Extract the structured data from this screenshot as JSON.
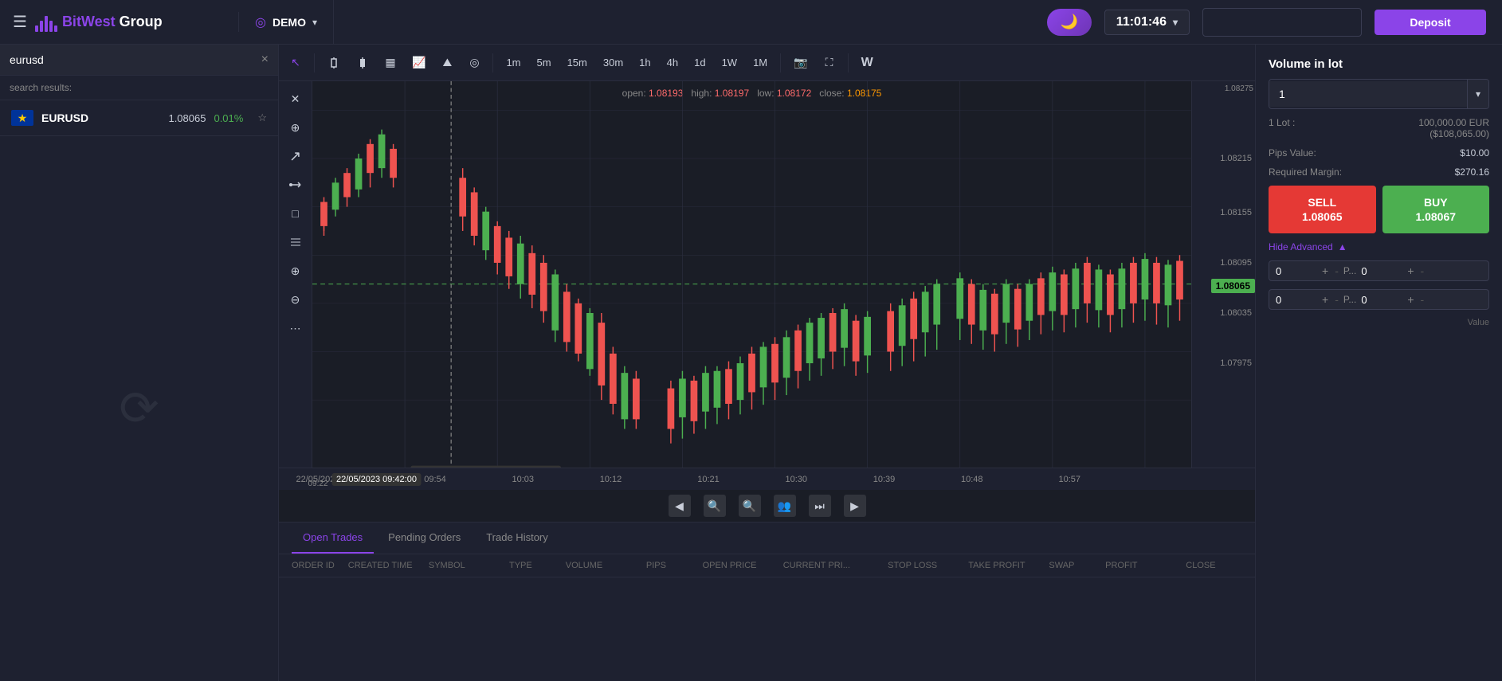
{
  "header": {
    "menu_icon": "☰",
    "logo_brand": "BitWest",
    "logo_suffix": " Group",
    "demo_label": "DEMO",
    "demo_arrow": "▾",
    "moon_icon": "🌙",
    "clock": "11:01:46",
    "clock_arrow": "▾",
    "deposit_label": "Deposit"
  },
  "search": {
    "placeholder": "eurusd",
    "results_label": "search results:",
    "clear_icon": "×",
    "results": [
      {
        "symbol": "EURUSD",
        "price": "1.08065",
        "change": "0.01%",
        "flag": "🇪🇺"
      }
    ]
  },
  "chart_toolbar": {
    "tools": [
      {
        "id": "cursor",
        "icon": "↖",
        "active": true
      },
      {
        "id": "separator1",
        "type": "sep"
      },
      {
        "id": "candle1",
        "icon": "⬜"
      },
      {
        "id": "candle2",
        "icon": "⬛"
      },
      {
        "id": "candle3",
        "icon": "▦"
      },
      {
        "id": "line",
        "icon": "📈"
      },
      {
        "id": "area",
        "icon": "⛰"
      },
      {
        "id": "heikin",
        "icon": "◎"
      },
      {
        "id": "separator2",
        "type": "sep"
      }
    ],
    "timeframes": [
      {
        "id": "1m",
        "label": "1m",
        "active": false
      },
      {
        "id": "5m",
        "label": "5m",
        "active": false
      },
      {
        "id": "15m",
        "label": "15m",
        "active": false
      },
      {
        "id": "30m",
        "label": "30m",
        "active": false
      },
      {
        "id": "1h",
        "label": "1h",
        "active": false
      },
      {
        "id": "4h",
        "label": "4h",
        "active": false
      },
      {
        "id": "1d",
        "label": "1d",
        "active": false
      },
      {
        "id": "1w",
        "label": "1W",
        "active": false
      },
      {
        "id": "1M",
        "label": "1M",
        "active": false
      }
    ],
    "extra_tools": [
      {
        "id": "camera",
        "icon": "📷"
      },
      {
        "id": "fullscreen",
        "icon": "⛶"
      },
      {
        "id": "separator3",
        "type": "sep"
      },
      {
        "id": "widget",
        "icon": "W"
      }
    ]
  },
  "left_tools": [
    {
      "id": "cross",
      "icon": "✕"
    },
    {
      "id": "zoom_in",
      "icon": "⊕"
    },
    {
      "id": "trend",
      "icon": "↗"
    },
    {
      "id": "shapes",
      "icon": "⚙"
    },
    {
      "id": "rect",
      "icon": "□"
    },
    {
      "id": "fib",
      "icon": "≡"
    },
    {
      "id": "zoom_plus",
      "icon": "⊕"
    },
    {
      "id": "zoom_minus",
      "icon": "⊖"
    },
    {
      "id": "more",
      "icon": "⋯"
    }
  ],
  "chart": {
    "info_bar": {
      "open_label": "open:",
      "open_value": "1.08193",
      "high_label": "high:",
      "high_value": "1.08197",
      "low_label": "low:",
      "low_value": "1.08172",
      "close_label": "close:",
      "close_value": "1.08175"
    },
    "price_levels": [
      {
        "value": "1.08275",
        "pct": 5,
        "highlighted": false
      },
      {
        "value": "1.08215",
        "pct": 18,
        "highlighted": false
      },
      {
        "value": "1.08155",
        "pct": 32,
        "highlighted": false
      },
      {
        "value": "1.08095",
        "pct": 45,
        "highlighted": false
      },
      {
        "value": "1.08065",
        "pct": 52,
        "highlighted": true,
        "color": "#4caf50"
      },
      {
        "value": "1.08035",
        "pct": 58,
        "highlighted": false
      },
      {
        "value": "1.07975",
        "pct": 72,
        "highlighted": false
      }
    ],
    "time_labels": [
      {
        "label": "22/05/2023",
        "pct": 4
      },
      {
        "label": "09:22",
        "pct": 4,
        "secondary": true
      },
      {
        "label": "09:54",
        "pct": 16
      },
      {
        "label": "10:03",
        "pct": 25
      },
      {
        "label": "10:12",
        "pct": 34
      },
      {
        "label": "10:21",
        "pct": 44
      },
      {
        "label": "10:30",
        "pct": 53
      },
      {
        "label": "10:39",
        "pct": 62
      },
      {
        "label": "10:48",
        "pct": 71
      },
      {
        "label": "10:57",
        "pct": 81
      }
    ],
    "tooltip": {
      "label": "22/05/2023 09:42:00"
    }
  },
  "bottom_panel": {
    "tabs": [
      {
        "id": "open-trades",
        "label": "Open Trades",
        "active": true
      },
      {
        "id": "pending-orders",
        "label": "Pending Orders",
        "active": false
      },
      {
        "id": "trade-history",
        "label": "Trade History",
        "active": false
      }
    ],
    "columns": [
      {
        "id": "order-id",
        "label": "ORDER ID"
      },
      {
        "id": "created-time",
        "label": "CREATED TIME"
      },
      {
        "id": "symbol",
        "label": "SYMBOL"
      },
      {
        "id": "type",
        "label": "TYPE"
      },
      {
        "id": "volume",
        "label": "VOLUME"
      },
      {
        "id": "pips",
        "label": "PIPS"
      },
      {
        "id": "open-price",
        "label": "OPEN PRICE"
      },
      {
        "id": "current-price",
        "label": "CURRENT PRI..."
      },
      {
        "id": "stop-loss",
        "label": "STOP LOSS"
      },
      {
        "id": "take-profit",
        "label": "TAKE PROFIT"
      },
      {
        "id": "swap",
        "label": "SWAP"
      },
      {
        "id": "profit",
        "label": "PROFIT"
      },
      {
        "id": "close",
        "label": "CLOSE"
      }
    ]
  },
  "right_sidebar": {
    "title": "Volume in lot",
    "lot_value": "1",
    "lot_info_label": "1 Lot :",
    "lot_info_value": "100,000.00 EUR",
    "lot_info_usd": "($108,065.00)",
    "pips_label": "Pips Value:",
    "pips_value": "$10.00",
    "margin_label": "Required Margin:",
    "margin_value": "$270.16",
    "sell_label": "SELL",
    "sell_price": "1.08065",
    "buy_label": "BUY",
    "buy_price": "1.08067",
    "hide_advanced_label": "Hide Advanced",
    "hide_advanced_icon": "▲",
    "adv_row1_left": "0",
    "adv_row1_right": "0",
    "adv_row2_left": "0",
    "adv_row2_right": "0",
    "value_label": "Value"
  }
}
